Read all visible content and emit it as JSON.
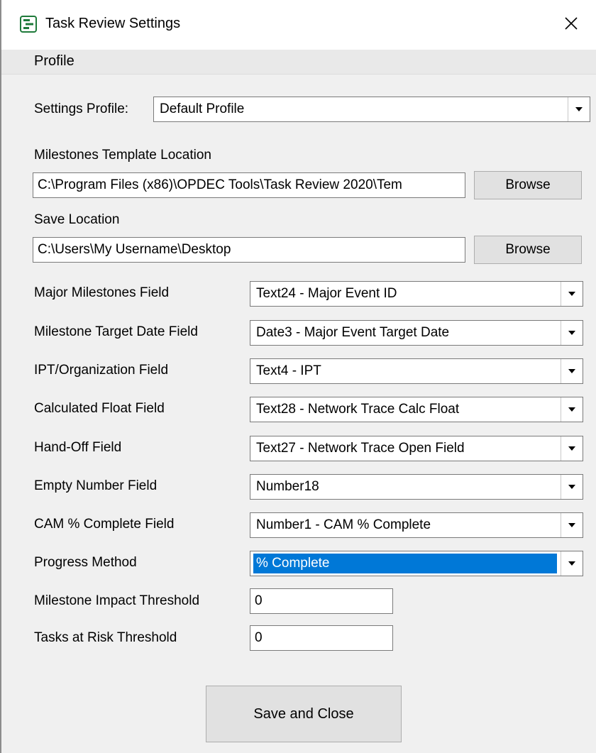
{
  "window": {
    "title": "Task Review Settings",
    "icon": "gantt-app-icon",
    "close_glyph": "✕"
  },
  "menu": {
    "items": [
      "Profile"
    ]
  },
  "settings_profile": {
    "label": "Settings Profile:",
    "value": "Default Profile"
  },
  "milestones_template": {
    "label": "Milestones Template Location",
    "value": "C:\\Program Files (x86)\\OPDEC Tools\\Task Review 2020\\Tem",
    "browse_label": "Browse"
  },
  "save_location": {
    "label": "Save Location",
    "value": "C:\\Users\\My Username\\Desktop",
    "browse_label": "Browse"
  },
  "fields": [
    {
      "label": "Major Milestones Field",
      "value": "Text24 - Major Event ID"
    },
    {
      "label": "Milestone Target Date Field",
      "value": "Date3 - Major Event Target Date"
    },
    {
      "label": "IPT/Organization Field",
      "value": "Text4 - IPT"
    },
    {
      "label": "Calculated Float Field",
      "value": "Text28 - Network Trace Calc Float"
    },
    {
      "label": "Hand-Off Field",
      "value": "Text27 - Network Trace Open Field"
    },
    {
      "label": "Empty Number Field",
      "value": "Number18"
    },
    {
      "label": "CAM % Complete Field",
      "value": "Number1 - CAM % Complete"
    },
    {
      "label": "Progress Method",
      "value": "% Complete",
      "selected": true
    }
  ],
  "thresholds": [
    {
      "label": "Milestone Impact Threshold",
      "value": "0"
    },
    {
      "label": "Tasks at Risk Threshold",
      "value": "0"
    }
  ],
  "save_button": {
    "label": "Save and Close"
  },
  "colors": {
    "selection": "#0078d7",
    "window_bg": "#f0f0f0",
    "icon_green": "#1e7a3a"
  }
}
